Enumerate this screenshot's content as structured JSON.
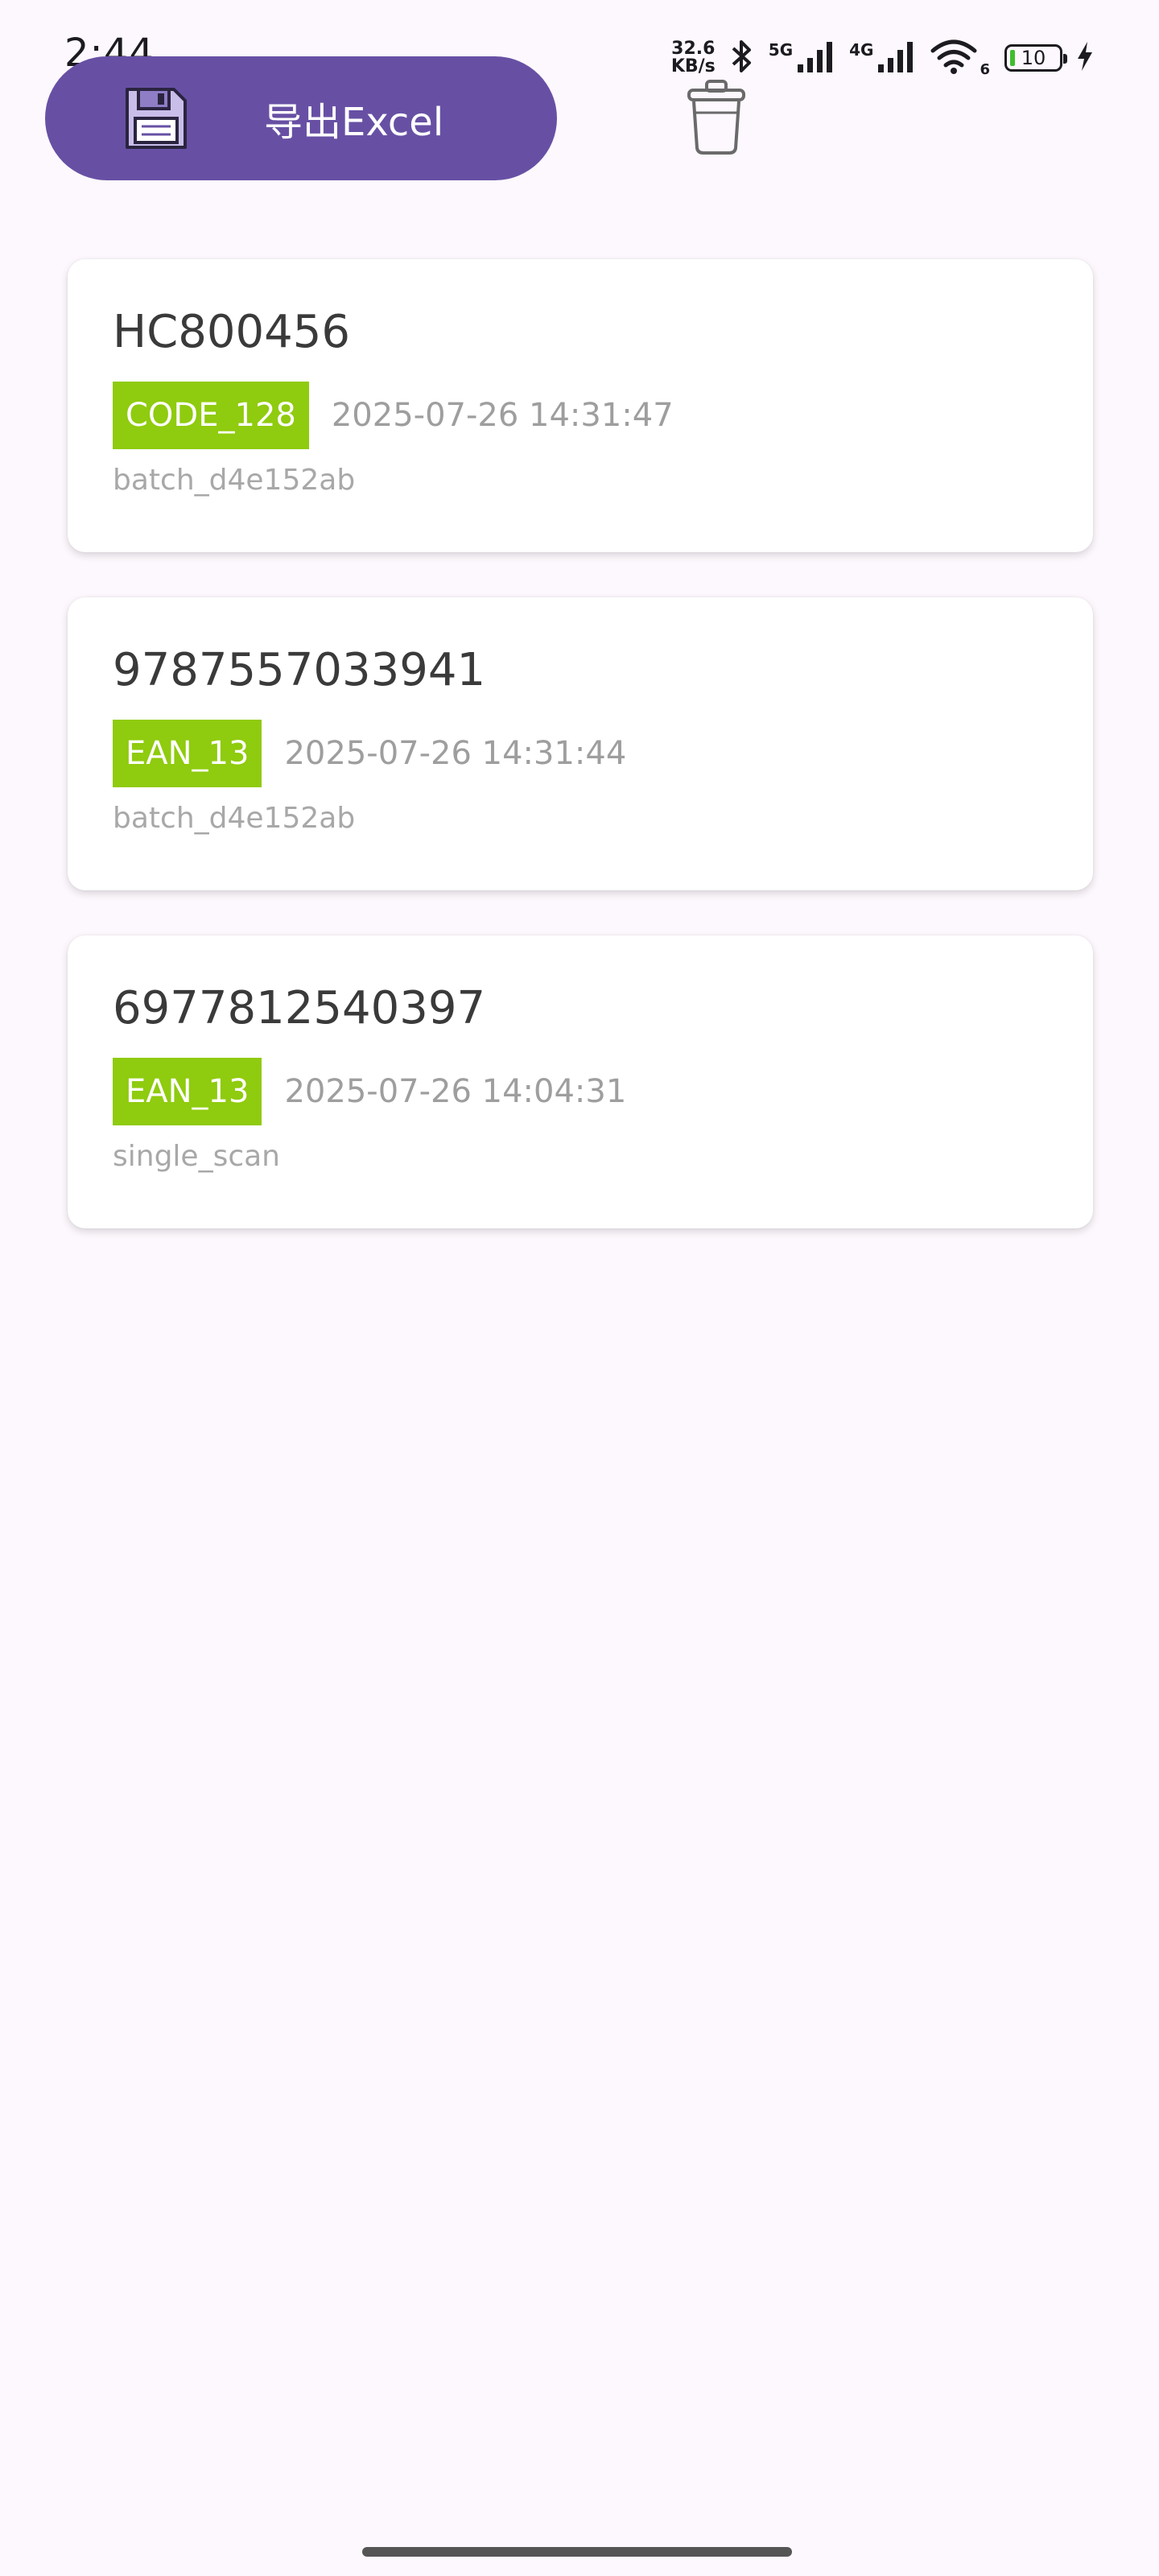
{
  "status_bar": {
    "time": "2:44",
    "net_speed_value": "32.6",
    "net_speed_unit": "KB/s",
    "signal_1_label": "5G",
    "signal_2_label": "4G",
    "wifi_label": "6",
    "battery_level": "10"
  },
  "toolbar": {
    "export_label": "导出Excel"
  },
  "records": [
    {
      "code": "HC800456",
      "type": "CODE_128",
      "time": "2025-07-26 14:31:47",
      "source": "batch_d4e152ab"
    },
    {
      "code": "9787557033941",
      "type": "EAN_13",
      "time": "2025-07-26 14:31:44",
      "source": "batch_d4e152ab"
    },
    {
      "code": "6977812540397",
      "type": "EAN_13",
      "time": "2025-07-26 14:04:31",
      "source": "single_scan"
    }
  ],
  "colors": {
    "accent": "#6750a4",
    "badge": "#8fcb0e",
    "background": "#fdf8fd"
  },
  "icons": {
    "export": "floppy-disk-icon",
    "delete": "trash-icon",
    "bluetooth": "bluetooth-icon",
    "wifi": "wifi-icon",
    "charging": "lightning-icon"
  }
}
